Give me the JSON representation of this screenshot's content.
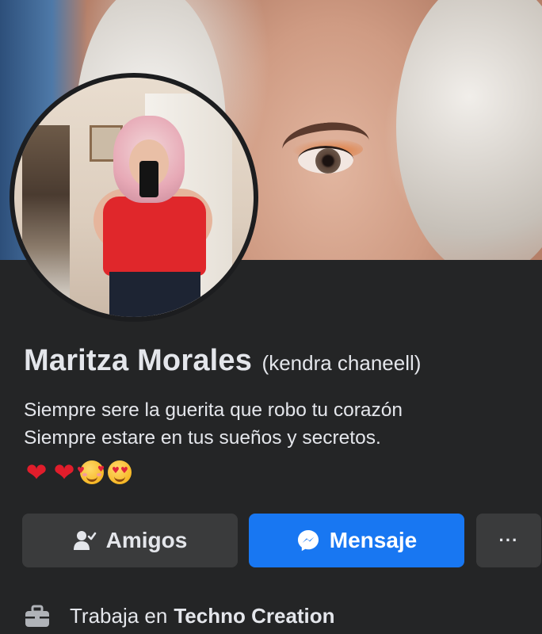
{
  "profile": {
    "name": "Maritza Morales",
    "alt_name": "(kendra chaneell)",
    "bio_line1": "Siempre sere la guerita que robo tu corazón",
    "bio_line2": "Siempre estare en tus sueños y secretos."
  },
  "emojis": [
    "red-heart",
    "red-heart",
    "smiling-face-with-hearts",
    "heart-eyes-face"
  ],
  "actions": {
    "friends_label": "Amigos",
    "message_label": "Mensaje",
    "more_label": "···"
  },
  "work": {
    "prefix": "Trabaja en",
    "company": "Techno Creation"
  },
  "colors": {
    "background": "#242526",
    "button_secondary": "#3a3b3c",
    "button_primary": "#1877f2",
    "text": "#e4e6eb"
  },
  "icons": {
    "friends": "person-check-icon",
    "message": "messenger-icon",
    "more": "more-dots-icon",
    "work": "briefcase-icon"
  }
}
